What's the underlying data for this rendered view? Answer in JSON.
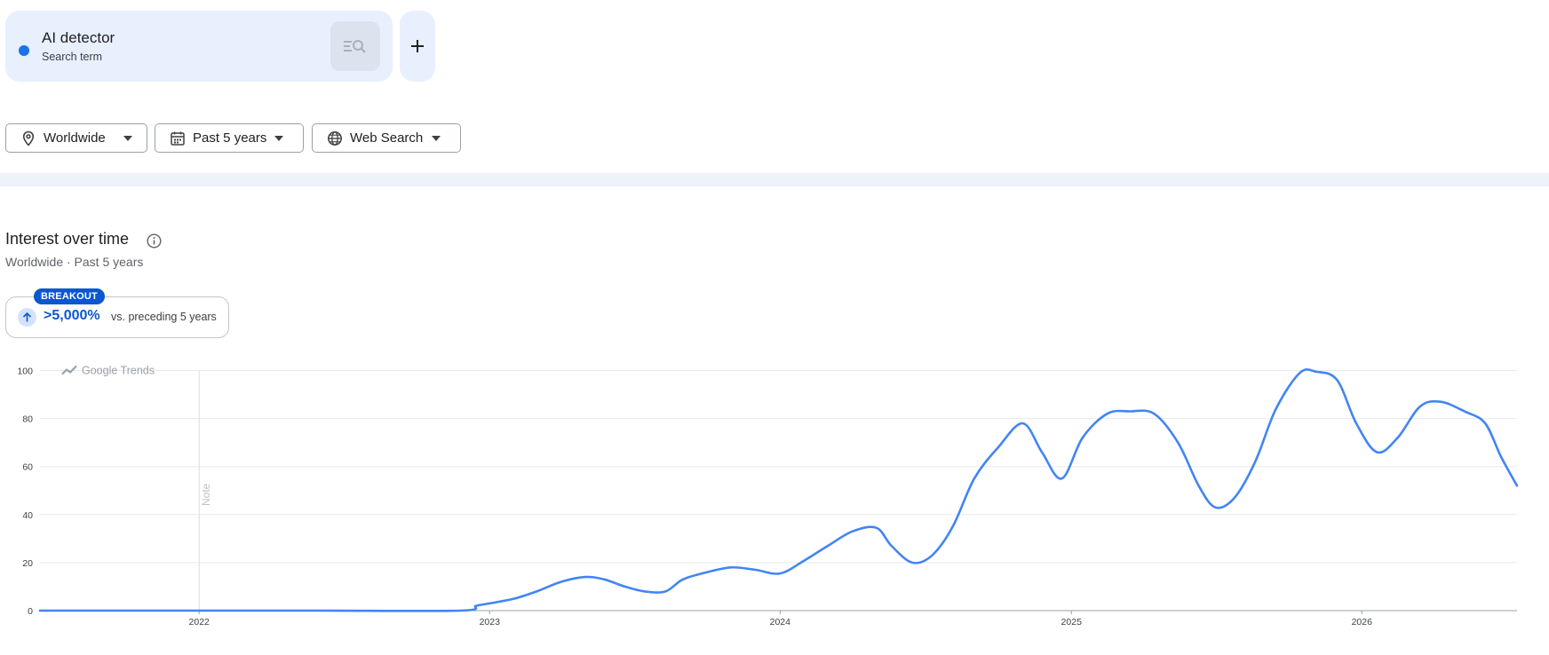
{
  "search_term": {
    "name": "AI detector",
    "type_label": "Search term",
    "color": "#1a73e8"
  },
  "add_term": {
    "icon": "plus-icon"
  },
  "filters": {
    "location": {
      "label": "Worldwide",
      "icon": "location-pin-icon"
    },
    "time_range": {
      "label": "Past 5 years",
      "icon": "calendar-icon"
    },
    "property": {
      "label": "Web Search",
      "icon": "globe-icon"
    }
  },
  "interest_section": {
    "title": "Interest over time",
    "subtitle": "Worldwide · Past 5 years",
    "breakout": {
      "badge": "BREAKOUT",
      "value": ">5,000%",
      "comparison": "vs. preceding 5 years"
    }
  },
  "chart_watermark": "Google Trends",
  "chart_note": "Note",
  "colors": {
    "series": "#4285f4",
    "accent": "#0b57d0"
  },
  "chart_data": {
    "type": "line",
    "title": "",
    "xlabel": "",
    "ylabel": "",
    "ylim": [
      0,
      100
    ],
    "yticks": [
      "0",
      "20",
      "40",
      "60",
      "80",
      "100"
    ],
    "xlim": [
      "2021-06",
      "2026-07"
    ],
    "xticks": [
      "2022",
      "2023",
      "2024",
      "2025",
      "2026"
    ],
    "grid": true,
    "annotations": [
      {
        "x": "2022-01",
        "text": "Note"
      }
    ],
    "series": [
      {
        "name": "AI detector",
        "color": "#4285f4",
        "points": [
          [
            "2021-06-15",
            0
          ],
          [
            "2022-01-01",
            0
          ],
          [
            "2022-06-01",
            0
          ],
          [
            "2022-11-25",
            0
          ],
          [
            "2022-12-15",
            2
          ],
          [
            "2023-01-01",
            3
          ],
          [
            "2023-02-01",
            5
          ],
          [
            "2023-03-01",
            8
          ],
          [
            "2023-04-01",
            12
          ],
          [
            "2023-05-01",
            14
          ],
          [
            "2023-05-25",
            13
          ],
          [
            "2023-06-20",
            10
          ],
          [
            "2023-07-15",
            8
          ],
          [
            "2023-08-10",
            8
          ],
          [
            "2023-09-01",
            13
          ],
          [
            "2023-10-01",
            16
          ],
          [
            "2023-11-01",
            18
          ],
          [
            "2023-12-01",
            17
          ],
          [
            "2024-01-01",
            15.5
          ],
          [
            "2024-02-01",
            21
          ],
          [
            "2024-03-01",
            27
          ],
          [
            "2024-04-01",
            33
          ],
          [
            "2024-05-01",
            34.5
          ],
          [
            "2024-05-20",
            27
          ],
          [
            "2024-06-15",
            20
          ],
          [
            "2024-07-10",
            23
          ],
          [
            "2024-08-05",
            35
          ],
          [
            "2024-09-01",
            55
          ],
          [
            "2024-10-01",
            68
          ],
          [
            "2024-11-01",
            78
          ],
          [
            "2024-11-25",
            66
          ],
          [
            "2024-12-20",
            55
          ],
          [
            "2025-01-15",
            72
          ],
          [
            "2025-02-15",
            82
          ],
          [
            "2025-03-15",
            83
          ],
          [
            "2025-04-15",
            82
          ],
          [
            "2025-05-15",
            70
          ],
          [
            "2025-06-10",
            52
          ],
          [
            "2025-07-01",
            43
          ],
          [
            "2025-07-25",
            47
          ],
          [
            "2025-08-20",
            62
          ],
          [
            "2025-09-15",
            84
          ],
          [
            "2025-10-15",
            99
          ],
          [
            "2025-11-05",
            99.5
          ],
          [
            "2025-12-01",
            96
          ],
          [
            "2025-12-25",
            78
          ],
          [
            "2026-01-20",
            66
          ],
          [
            "2026-02-15",
            72
          ],
          [
            "2026-03-15",
            85
          ],
          [
            "2026-04-10",
            87
          ],
          [
            "2026-05-10",
            83
          ],
          [
            "2026-06-05",
            78
          ],
          [
            "2026-06-25",
            64
          ],
          [
            "2026-07-15",
            52
          ]
        ]
      }
    ]
  }
}
